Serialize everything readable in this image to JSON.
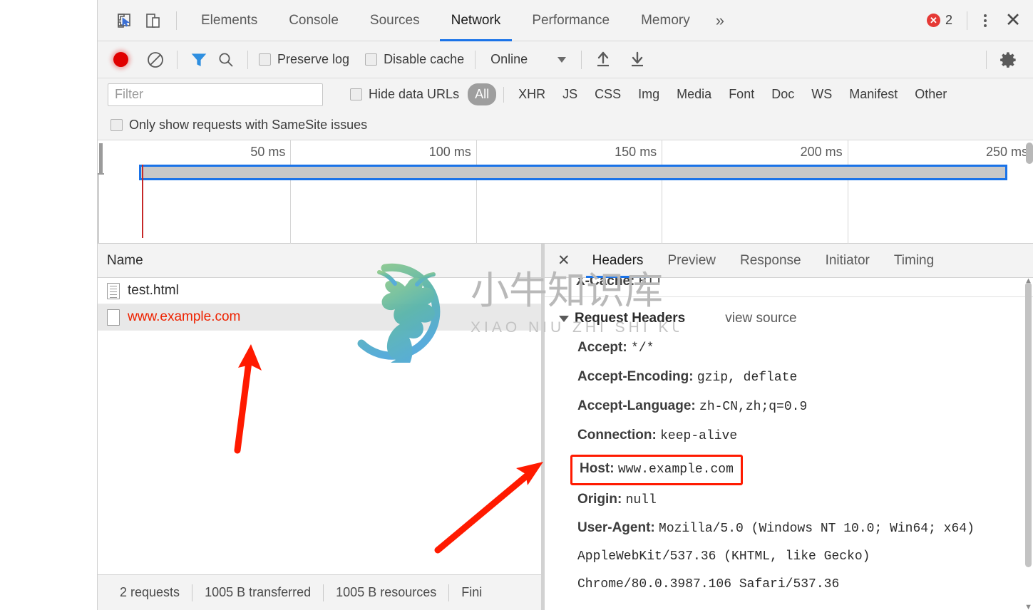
{
  "devtools": {
    "main_tabs": [
      {
        "label": "Elements",
        "active": false
      },
      {
        "label": "Console",
        "active": false
      },
      {
        "label": "Sources",
        "active": false
      },
      {
        "label": "Network",
        "active": true
      },
      {
        "label": "Performance",
        "active": false
      },
      {
        "label": "Memory",
        "active": false
      }
    ],
    "more_tabs_glyph": "»",
    "error_count": "2",
    "inspect_icon": "inspect-element-icon",
    "device_icon": "device-toolbar-icon",
    "menu_icon": "kebab-menu-icon",
    "close_icon": "close-icon"
  },
  "network_toolbar": {
    "record_label": "record-button",
    "clear_label": "clear-button",
    "filter_toggle_label": "filter-funnel-icon",
    "search_label": "search-icon",
    "preserve_log": {
      "label": "Preserve log",
      "checked": false
    },
    "disable_cache": {
      "label": "Disable cache",
      "checked": false
    },
    "throttle_value": "Online",
    "import_icon": "import-har-icon",
    "export_icon": "export-har-icon",
    "settings_icon": "gear-icon"
  },
  "filter_bar": {
    "placeholder": "Filter",
    "value": "",
    "hide_data_urls": {
      "label": "Hide data URLs",
      "checked": false
    },
    "types": [
      {
        "label": "All",
        "active": true
      },
      {
        "label": "XHR",
        "active": false
      },
      {
        "label": "JS",
        "active": false
      },
      {
        "label": "CSS",
        "active": false
      },
      {
        "label": "Img",
        "active": false
      },
      {
        "label": "Media",
        "active": false
      },
      {
        "label": "Font",
        "active": false
      },
      {
        "label": "Doc",
        "active": false
      },
      {
        "label": "WS",
        "active": false
      },
      {
        "label": "Manifest",
        "active": false
      },
      {
        "label": "Other",
        "active": false
      }
    ]
  },
  "samesite_bar": {
    "label": "Only show requests with SameSite issues",
    "checked": false
  },
  "overview": {
    "ticks": [
      "50 ms",
      "100 ms",
      "150 ms",
      "200 ms",
      "250 ms"
    ],
    "band_color": "#1a73e8",
    "marker_color": "#c62828"
  },
  "request_list": {
    "column_header": "Name",
    "rows": [
      {
        "name": "test.html",
        "icon": "document-icon",
        "error": false,
        "selected": false
      },
      {
        "name": "www.example.com",
        "icon": "blank-document-icon",
        "error": true,
        "selected": true
      }
    ]
  },
  "status_bar": {
    "requests": "2 requests",
    "transferred": "1005 B transferred",
    "resources": "1005 B resources",
    "finish_truncated": "Fini"
  },
  "detail_panel": {
    "close_icon": "close-detail-icon",
    "tabs": [
      {
        "label": "Headers",
        "active": true
      },
      {
        "label": "Preview",
        "active": false
      },
      {
        "label": "Response",
        "active": false
      },
      {
        "label": "Initiator",
        "active": false
      },
      {
        "label": "Timing",
        "active": false
      }
    ],
    "clipped_header": {
      "name": "X-Cache:",
      "value": "HIT"
    },
    "section_title": "Request Headers",
    "view_source_label": "view source",
    "headers": [
      {
        "name": "Accept:",
        "value": "*/*",
        "highlight": false
      },
      {
        "name": "Accept-Encoding:",
        "value": "gzip, deflate",
        "highlight": false
      },
      {
        "name": "Accept-Language:",
        "value": "zh-CN,zh;q=0.9",
        "highlight": false
      },
      {
        "name": "Connection:",
        "value": "keep-alive",
        "highlight": false
      },
      {
        "name": "Host:",
        "value": "www.example.com",
        "highlight": true
      },
      {
        "name": "Origin:",
        "value": "null",
        "highlight": false
      }
    ],
    "user_agent": {
      "name": "User-Agent:",
      "value": "Mozilla/5.0 (Windows NT 10.0; Win64; x64) AppleWebKit/537.36 (KHTML, like Gecko) Chrome/80.0.3987.106 Safari/537.36"
    }
  },
  "watermark": {
    "cn_text": "小牛知识库",
    "pinyin_text": "XIAO NIU ZHI SHI KU",
    "logo_name": "ox-logo"
  },
  "annotations": {
    "arrow_color": "#ff1a00",
    "highlight_box_color": "#ff1a00"
  },
  "colors": {
    "accent_blue": "#1a73e8",
    "error_red": "#ee2200",
    "toolbar_bg": "#f3f3f3"
  }
}
